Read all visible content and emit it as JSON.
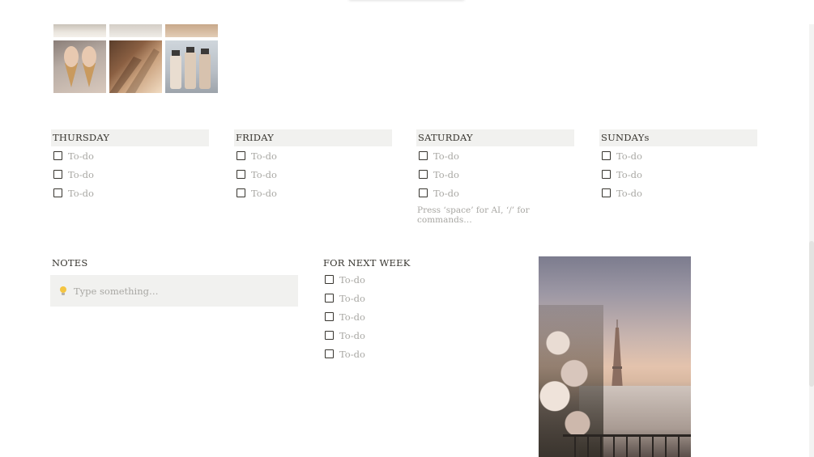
{
  "days": [
    {
      "key": "thursday",
      "title": "THURSDAY",
      "todos": [
        "To-do",
        "To-do",
        "To-do"
      ]
    },
    {
      "key": "friday",
      "title": "FRIDAY",
      "todos": [
        "To-do",
        "To-do",
        "To-do"
      ]
    },
    {
      "key": "saturday",
      "title": "SATURDAY",
      "todos": [
        "To-do",
        "To-do",
        "To-do"
      ],
      "hint": "Press ‘space’ for AI, ‘/’ for commands…"
    },
    {
      "key": "sunday",
      "title": "SUNDAYs",
      "todos": [
        "To-do",
        "To-do",
        "To-do"
      ]
    }
  ],
  "notes": {
    "title": "NOTES",
    "placeholder": "Type something…",
    "icon": "lightbulb-icon"
  },
  "next_week": {
    "title": "FOR NEXT WEEK",
    "todos": [
      "To-do",
      "To-do",
      "To-do",
      "To-do",
      "To-do"
    ]
  },
  "colors": {
    "header_bg": "#f1f1ef",
    "text": "#37352f",
    "placeholder": "#a8a7a3"
  }
}
